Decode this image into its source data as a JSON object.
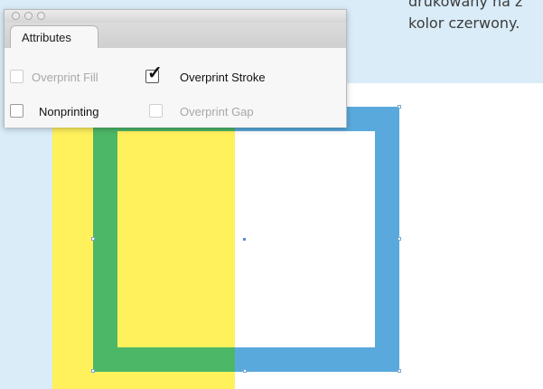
{
  "caption": {
    "line1": "drukowany na z",
    "line2": "kolor czerwony."
  },
  "panel": {
    "tab_label": "Attributes",
    "options": {
      "overprint_fill": {
        "label": "Overprint Fill",
        "checked": false,
        "enabled": false
      },
      "overprint_stroke": {
        "label": "Overprint Stroke",
        "checked": true,
        "enabled": true
      },
      "nonprinting": {
        "label": "Nonprinting",
        "checked": false,
        "enabled": true
      },
      "overprint_gap": {
        "label": "Overprint Gap",
        "checked": false,
        "enabled": false
      }
    }
  },
  "colors": {
    "page_background": "#d9ecf8",
    "yellow_fill": "#fff15c",
    "blue_stroke": "#5aa9dd",
    "green_overlap": "#4cb767"
  }
}
